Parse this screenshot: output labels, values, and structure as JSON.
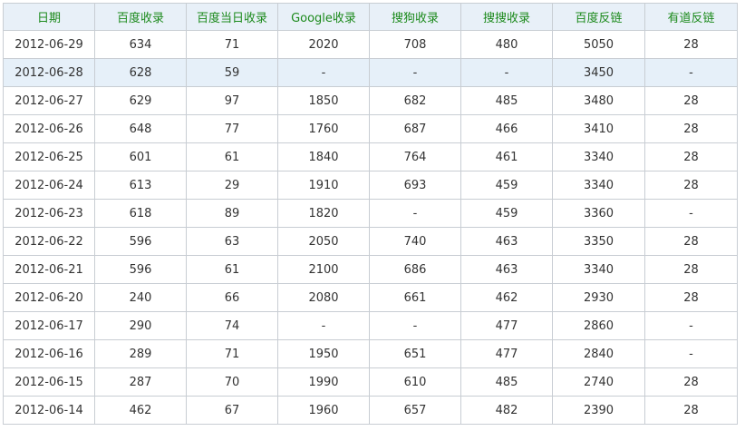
{
  "table": {
    "headers": [
      "日期",
      "百度收录",
      "百度当日收录",
      "Google收录",
      "搜狗收录",
      "搜搜收录",
      "百度反链",
      "有道反链"
    ],
    "highlight_row": 1,
    "rows": [
      [
        "2012-06-29",
        "634",
        "71",
        "2020",
        "708",
        "480",
        "5050",
        "28"
      ],
      [
        "2012-06-28",
        "628",
        "59",
        "-",
        "-",
        "-",
        "3450",
        "-"
      ],
      [
        "2012-06-27",
        "629",
        "97",
        "1850",
        "682",
        "485",
        "3480",
        "28"
      ],
      [
        "2012-06-26",
        "648",
        "77",
        "1760",
        "687",
        "466",
        "3410",
        "28"
      ],
      [
        "2012-06-25",
        "601",
        "61",
        "1840",
        "764",
        "461",
        "3340",
        "28"
      ],
      [
        "2012-06-24",
        "613",
        "29",
        "1910",
        "693",
        "459",
        "3340",
        "28"
      ],
      [
        "2012-06-23",
        "618",
        "89",
        "1820",
        "-",
        "459",
        "3360",
        "-"
      ],
      [
        "2012-06-22",
        "596",
        "63",
        "2050",
        "740",
        "463",
        "3350",
        "28"
      ],
      [
        "2012-06-21",
        "596",
        "61",
        "2100",
        "686",
        "463",
        "3340",
        "28"
      ],
      [
        "2012-06-20",
        "240",
        "66",
        "2080",
        "661",
        "462",
        "2930",
        "28"
      ],
      [
        "2012-06-17",
        "290",
        "74",
        "-",
        "-",
        "477",
        "2860",
        "-"
      ],
      [
        "2012-06-16",
        "289",
        "71",
        "1950",
        "651",
        "477",
        "2840",
        "-"
      ],
      [
        "2012-06-15",
        "287",
        "70",
        "1990",
        "610",
        "485",
        "2740",
        "28"
      ],
      [
        "2012-06-14",
        "462",
        "67",
        "1960",
        "657",
        "482",
        "2390",
        "28"
      ]
    ]
  }
}
